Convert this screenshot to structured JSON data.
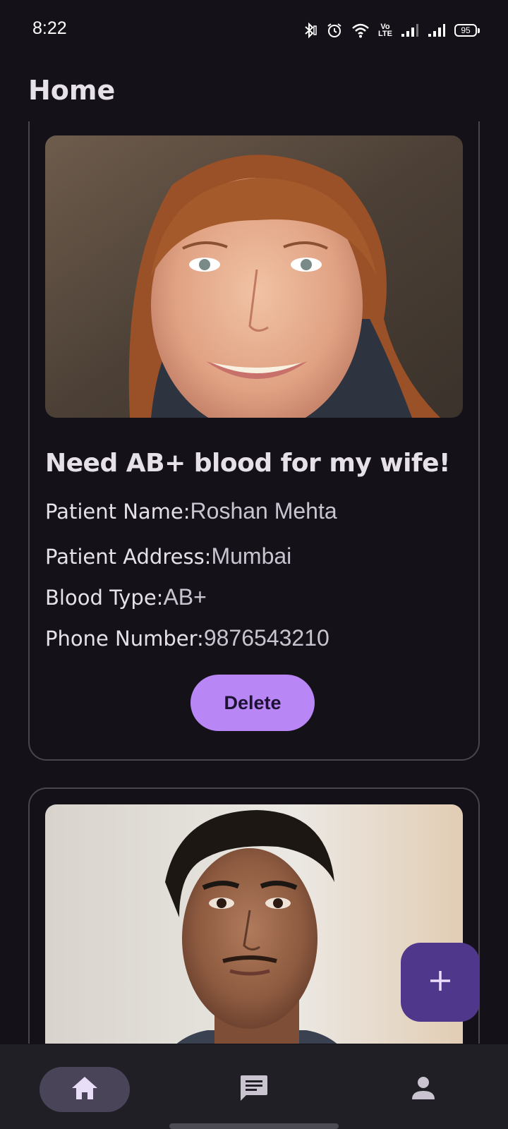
{
  "status_bar": {
    "time": "8:22",
    "volte_top": "Vo",
    "volte_bottom": "LTE",
    "battery": "95",
    "icons": [
      "bluetooth-icon",
      "alarm-icon",
      "wifi-icon",
      "volte-icon",
      "signal-icon",
      "signal-icon",
      "battery-icon"
    ]
  },
  "header": {
    "title": "Home"
  },
  "cards": [
    {
      "photo": "patient-photo",
      "title": "Need AB+ blood for my wife!",
      "fields": [
        {
          "label": "Patient Name:",
          "value": "Roshan Mehta"
        },
        {
          "label": "Patient Address:",
          "value": "Mumbai"
        },
        {
          "label": "Blood Type:",
          "value": "AB+"
        },
        {
          "label": "Phone Number:",
          "value": "9876543210"
        }
      ],
      "delete_label": "Delete"
    },
    {
      "photo": "patient-photo"
    }
  ],
  "fab": {
    "icon": "plus-icon"
  },
  "bottom_nav": {
    "items": [
      {
        "icon": "home-icon",
        "selected": true
      },
      {
        "icon": "chat-icon",
        "selected": false
      },
      {
        "icon": "person-icon",
        "selected": false
      }
    ]
  },
  "colors": {
    "background": "#141218",
    "accent": "#b986f5",
    "fab": "#4f378b",
    "nav_bar": "#211f26",
    "nav_selected": "#4a4458"
  }
}
